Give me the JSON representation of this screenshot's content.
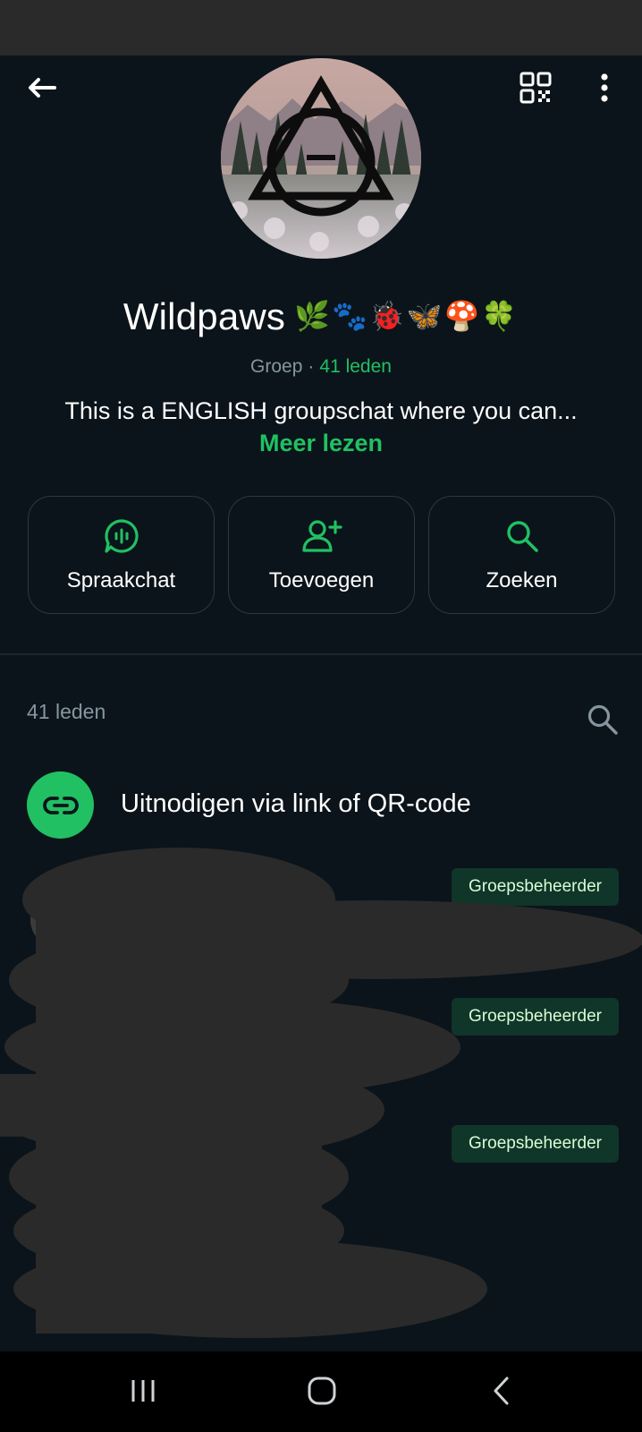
{
  "header": {
    "back_icon": "arrow-left-icon",
    "qr_icon": "qr-code-icon",
    "menu_icon": "more-vertical-icon"
  },
  "group": {
    "name": "Wildpaws",
    "emojis": "🌿🐾🐞🦋🍄🍀",
    "type_label": "Groep",
    "separator": "·",
    "member_count_label": "41 leden",
    "description": "This is a ENGLISH groupschat where you can...",
    "read_more": "Meer lezen"
  },
  "actions": [
    {
      "label": "Spraakchat",
      "icon": "voice-chat-icon"
    },
    {
      "label": "Toevoegen",
      "icon": "add-person-icon"
    },
    {
      "label": "Zoeken",
      "icon": "search-icon"
    }
  ],
  "members": {
    "header": "41 leden",
    "invite_label": "Uitnodigen via link of QR-code",
    "invite_icon": "link-icon",
    "admin_badges": [
      "Groepsbeheerder",
      "Groepsbeheerder",
      "Groepsbeheerder"
    ]
  },
  "navbar": {
    "recents_icon": "recents-icon",
    "home_icon": "home-icon",
    "back_icon": "nav-back-icon"
  },
  "colors": {
    "background": "#0b141a",
    "accent": "#21c063",
    "badge_bg": "#103529",
    "muted_text": "#8696a0",
    "redaction": "#2a2a2a"
  }
}
